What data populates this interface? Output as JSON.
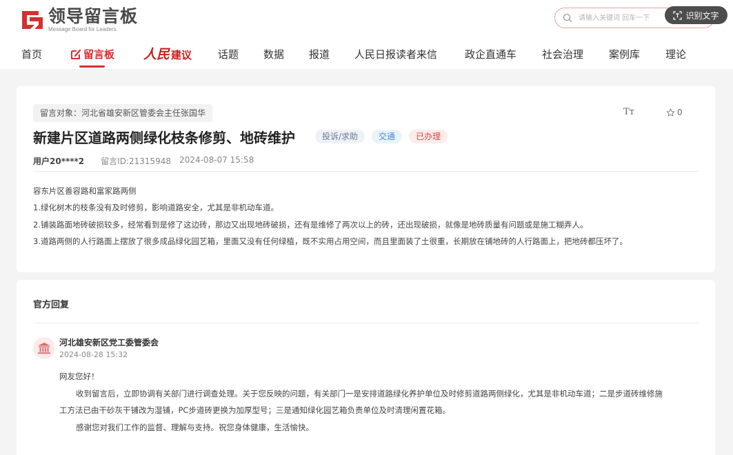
{
  "header": {
    "logo_cn": "领导留言板",
    "logo_en": "Message Board for Leaders",
    "search_placeholder": "请输入关键词 回车一下",
    "ocr_label": "识别文字"
  },
  "nav": {
    "items": [
      {
        "label": "首页"
      },
      {
        "label": "留言板"
      },
      {
        "brand_script": "人民",
        "brand_text": "建议"
      },
      {
        "label": "话题"
      },
      {
        "label": "数据"
      },
      {
        "label": "报道"
      },
      {
        "label": "人民日报读者来信"
      },
      {
        "label": "政企直通车"
      },
      {
        "label": "社会治理"
      },
      {
        "label": "案例库"
      },
      {
        "label": "理论"
      }
    ]
  },
  "message": {
    "target": "留言对象：河北省雄安新区管委会主任张国华",
    "font_toggle": "Tт",
    "favorite_count": "0",
    "title": "新建片区道路两侧绿化枝条修剪、地砖维护",
    "badges": {
      "type": "投诉/求助",
      "domain": "交通",
      "status": "已办理"
    },
    "user": "用户20****2",
    "message_id": "留言ID:21315948",
    "date": "2024-08-07 15:58",
    "body": [
      "容东片区善容路和富家路两侧",
      "1.绿化树木的枝条没有及时修剪，影响道路安全，尤其是非机动车道。",
      "2.铺装路面地砖破损较多，经常看到是修了这边砖，那边又出现地砖破损，还有是维修了两次以上的砖，还出现破损，就像是地砖质量有问题或是施工糊弄人。",
      "3.道路两侧的人行路面上摆放了很多成品绿化园艺箱，里面又没有任何绿植，既不实用占用空间，而且里面装了土很重，长期放在铺地砖的人行路面上，把地砖都压坏了。"
    ]
  },
  "reply": {
    "header": "官方回复",
    "org_name": "河北雄安新区党工委管委会",
    "date": "2024-08-28 15:32",
    "greeting": "网友您好！",
    "line1": "收到留言后，立即协调有关部门进行调查处理。关于您反映的问题，有关部门一是安排道路绿化养护单位及时修剪道路两侧绿化，尤其是非机动车道；二是步道砖维修施",
    "line2": "工方法已由干砂灰干铺改为湿铺，PC步道砖更换为加厚型号；三是通知绿化园艺箱负责单位及时清理闲置花箱。",
    "closing": "感谢您对我们工作的监督、理解与支持。祝您身体健康，生活愉快。"
  },
  "colors": {
    "accent": "#d62f2f",
    "badge_status": "#d94848",
    "badge_domain": "#4a8bd1"
  }
}
